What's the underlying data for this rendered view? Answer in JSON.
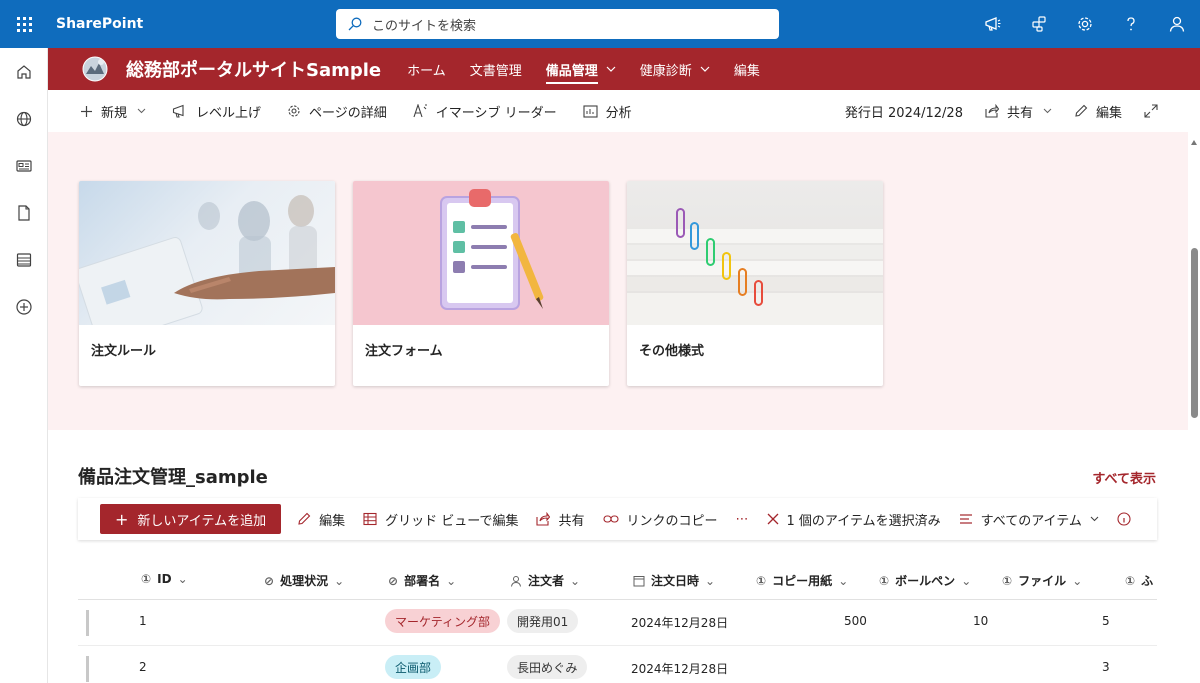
{
  "suite": {
    "app_name": "SharePoint",
    "search_placeholder": "このサイトを検索",
    "icons": [
      "megaphone-icon",
      "apps-share-icon",
      "gear-icon",
      "help-icon",
      "person-icon"
    ]
  },
  "rail": {
    "icons": [
      "home-icon",
      "globe-icon",
      "news-icon",
      "document-icon",
      "list-icon",
      "add-circle-icon"
    ]
  },
  "hub": {
    "site_title": "総務部ポータルサイトSample",
    "items": [
      {
        "label": "ホーム",
        "has_menu": false
      },
      {
        "label": "文書管理",
        "has_menu": false
      },
      {
        "label": "備品管理",
        "has_menu": true,
        "active": true
      },
      {
        "label": "健康診断",
        "has_menu": true
      },
      {
        "label": "編集",
        "has_menu": false
      }
    ],
    "accent_color": "#a4262c"
  },
  "command_bar": {
    "new": "新規",
    "promote": "レベル上げ",
    "page_details": "ページの詳細",
    "immersive_reader": "イマーシブ リーダー",
    "analytics": "分析",
    "published": "発行日 2024/12/28",
    "share": "共有",
    "edit": "編集"
  },
  "hero": {
    "cards": [
      {
        "label": "注文ルール"
      },
      {
        "label": "注文フォーム"
      },
      {
        "label": "その他様式"
      }
    ]
  },
  "list": {
    "title": "備品注文管理_sample",
    "see_all": "すべて表示",
    "toolbar": {
      "add": "新しいアイテムを追加",
      "edit": "編集",
      "grid_edit": "グリッド ビューで編集",
      "share": "共有",
      "copy_link": "リンクのコピー",
      "more": "⋯",
      "selected": "1 個のアイテムを選択済み",
      "view": "すべてのアイテム"
    },
    "columns": [
      "ID",
      "処理状況",
      "部署名",
      "注文者",
      "注文日時",
      "コピー用紙",
      "ボールペン",
      "ファイル",
      "ふ"
    ],
    "rows": [
      {
        "id": "1",
        "dept": "マーケティング部",
        "orderer": "開発用01",
        "date": "2024年12月28日",
        "paper": "500",
        "pen": "10",
        "file": "5"
      },
      {
        "id": "2",
        "dept": "企画部",
        "orderer": "長田めぐみ",
        "date": "2024年12月28日",
        "paper": "",
        "pen": "",
        "file": "3"
      }
    ]
  }
}
